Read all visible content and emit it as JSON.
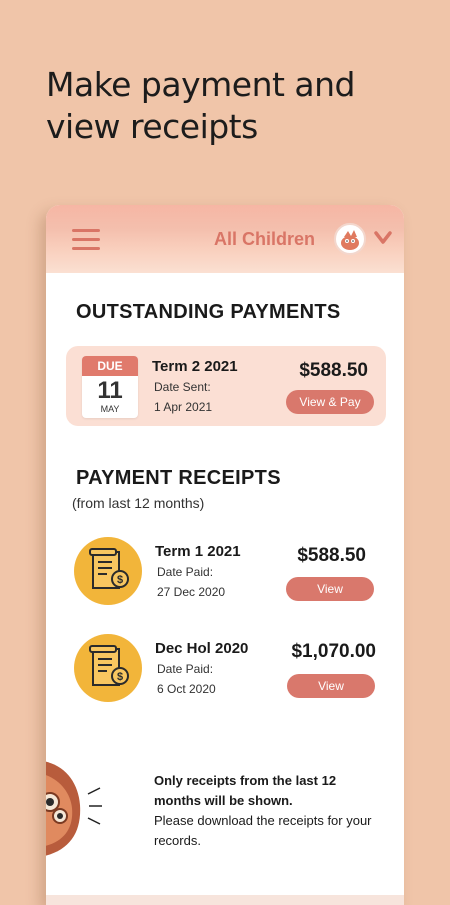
{
  "promo": {
    "title": "Make payment and view receipts"
  },
  "appbar": {
    "child_selector": "All Children"
  },
  "outstanding": {
    "title": "OUTSTANDING PAYMENTS",
    "item": {
      "due_label": "DUE",
      "due_day": "11",
      "due_month": "MAY",
      "title": "Term 2 2021",
      "date_label": "Date Sent:",
      "date": "1 Apr 2021",
      "amount": "$588.50",
      "button": "View & Pay"
    }
  },
  "receipts": {
    "title": "PAYMENT RECEIPTS",
    "subtitle": "(from last 12 months)",
    "items": [
      {
        "title": "Term 1 2021",
        "date_label": "Date Paid:",
        "date": "27 Dec 2020",
        "amount": "$588.50",
        "button": "View"
      },
      {
        "title": "Dec Hol 2020",
        "date_label": "Date Paid:",
        "date": "6 Oct 2020",
        "amount": "$1,070.00",
        "button": "View"
      }
    ]
  },
  "note": {
    "bold": "Only receipts from the last 12 months will be shown.",
    "normal": "Please download the receipts for your records."
  },
  "colors": {
    "accent": "#d9786c",
    "background": "#f0c5a9",
    "card": "#fbdfd4",
    "receipt_icon": "#f2b53a"
  }
}
